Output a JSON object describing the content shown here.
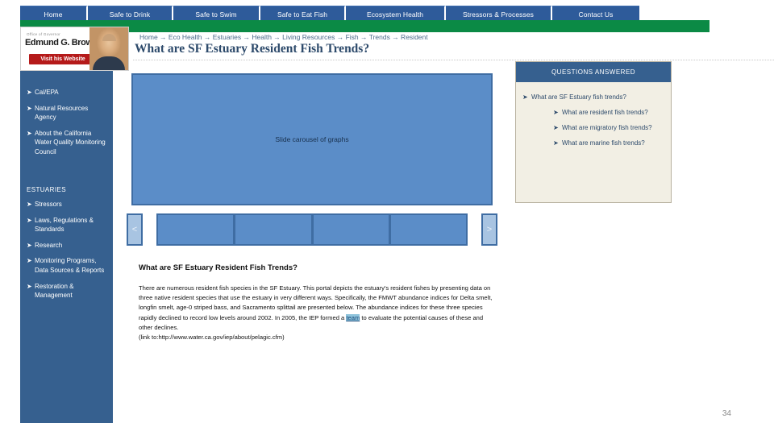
{
  "topnav": {
    "tabs": [
      {
        "label": "Home"
      },
      {
        "label": "Safe to Drink"
      },
      {
        "label": "Safe to Swim"
      },
      {
        "label": "Safe to Eat Fish"
      },
      {
        "label": "Ecosystem Health"
      },
      {
        "label": "Stressors & Processes"
      },
      {
        "label": "Contact Us"
      }
    ]
  },
  "governor_badge": {
    "office_label": "Office of Governor",
    "name": "Edmund G. Brown Jr.",
    "button_label": "Visit his Website"
  },
  "sidebar": {
    "top_links": [
      {
        "bullet": "➤",
        "label": "Cal/EPA"
      },
      {
        "bullet": "➤",
        "label": "Natural Resources Agency"
      },
      {
        "bullet": "➤",
        "label": "About the California Water Quality Monitoring Council"
      }
    ],
    "section_heading": "ESTUARIES",
    "section_links": [
      {
        "bullet": "➤",
        "label": "Stressors"
      },
      {
        "bullet": "➤",
        "label": "Laws, Regulations & Standards"
      },
      {
        "bullet": "➤",
        "label": "Research"
      },
      {
        "bullet": "➤",
        "label": "Monitoring Programs, Data Sources & Reports"
      },
      {
        "bullet": "➤",
        "label": "Restoration & Management"
      }
    ]
  },
  "header": {
    "breadcrumb": "Home → Eco Health → Estuaries → Health → Living Resources → Fish → Trends → Resident",
    "title": "What are SF Estuary Resident Fish Trends?"
  },
  "carousel": {
    "main_label": "Slide carousel of graphs",
    "prev_label": "<",
    "next_label": ">",
    "thumbnail_count": 4
  },
  "body": {
    "heading": "What are SF Estuary Resident Fish Trends?",
    "paragraph_part1": "There are numerous resident fish species in the SF Estuary. This portal depicts the estuary's resident fishes by presenting data on three native resident species that use the estuary in very different ways. Specifically, the FMWT abundance indices for Delta smelt, longfin smelt, age-0 striped bass, and Sacramento splittail are presented below. The abundance indices for these three species rapidly declined to record low levels around 2002. In 2005, the IEP formed a",
    "link_text": "team",
    "paragraph_part2": "to evaluate the potential causes of these and other declines.",
    "link_note": "(link to:http://www.water.ca.gov/iep/about/pelagic.cfm)"
  },
  "questions_answered": {
    "header": "QUESTIONS ANSWERED",
    "items": [
      {
        "bullet": "➤",
        "label": "What are SF Estuary fish trends?",
        "level": 1
      },
      {
        "bullet": "➤",
        "label": "What are resident fish trends?",
        "level": 2
      },
      {
        "bullet": "➤",
        "label": "What are migratory fish trends?",
        "level": 2
      },
      {
        "bullet": "➤",
        "label": "What are marine fish trends?",
        "level": 2
      }
    ]
  },
  "footer": {
    "page_number": "34"
  },
  "colors": {
    "nav_blue": "#2e5b9a",
    "green_bar": "#0b8a45",
    "sidebar_blue": "#36608f",
    "slide_blue": "#5b8dc8",
    "panel_cream": "#f2efe4",
    "badge_red": "#b51a1a"
  }
}
